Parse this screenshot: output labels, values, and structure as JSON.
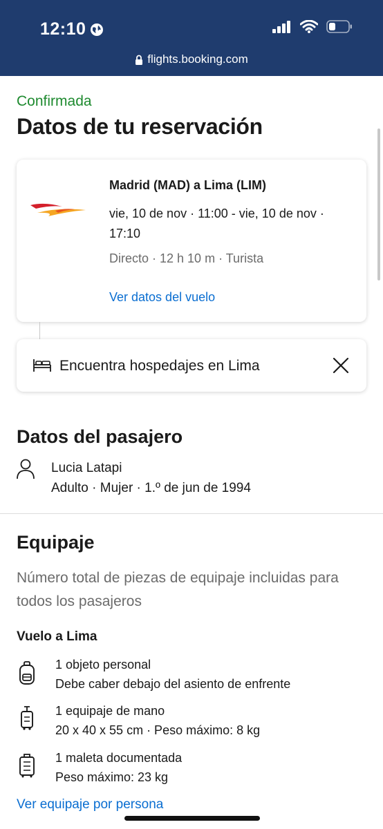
{
  "status_bar": {
    "time": "12:10"
  },
  "url_bar": {
    "url": "flights.booking.com"
  },
  "header": {
    "status": "Confirmada",
    "title": "Datos de tu reservación"
  },
  "flight": {
    "route": "Madrid (MAD) a Lima (LIM)",
    "times": "vie, 10 de nov · 11:00 - vie, 10 de nov · 17:10",
    "details": "Directo · 12 h 10 m · Turista",
    "link": "Ver datos del vuelo"
  },
  "hotel": {
    "text": "Encuentra hospedajes en Lima"
  },
  "passenger": {
    "section_title": "Datos del pasajero",
    "name": "Lucia Latapi",
    "info": "Adulto · Mujer · 1.º de jun de 1994"
  },
  "baggage": {
    "section_title": "Equipaje",
    "description": "Número total de piezas de equipaje incluidas para todos los pasajeros",
    "leg_title": "Vuelo a Lima",
    "items": [
      {
        "title": "1 objeto personal",
        "subtitle": "Debe caber debajo del asiento de enfrente",
        "icon": "backpack-icon"
      },
      {
        "title": "1 equipaje de mano",
        "subtitle": "20 x 40 x 55 cm · Peso máximo: 8 kg",
        "icon": "carry-on-icon"
      },
      {
        "title": "1 maleta documentada",
        "subtitle": "Peso máximo: 23 kg",
        "icon": "checked-bag-icon"
      }
    ],
    "link": "Ver equipaje por persona"
  },
  "colors": {
    "header_bg": "#1f3c6e",
    "confirmed": "#1e8a2f",
    "link": "#0a6ed1",
    "airline_red": "#d4202c",
    "airline_orange": "#f5a623"
  }
}
